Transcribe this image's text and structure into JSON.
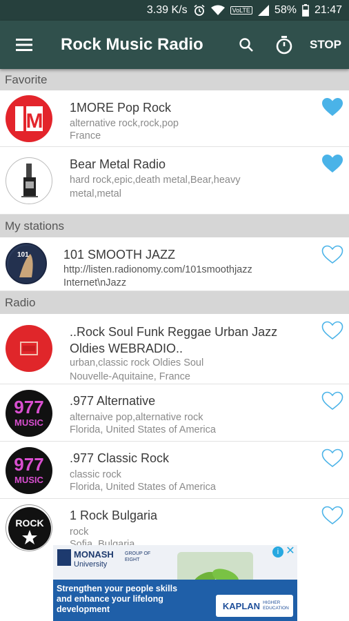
{
  "status_bar": {
    "speed": "3.39 K/s",
    "network_badge": "VoLTE",
    "battery": "58%",
    "time": "21:47"
  },
  "app_bar": {
    "title": "Rock Music Radio",
    "stop_label": "STOP"
  },
  "colors": {
    "app_bar": "#30504c",
    "status_bar": "#26403d",
    "heart": "#4ab3e8",
    "section_bg": "#d6d6d6"
  },
  "sections": {
    "favorite": "Favorite",
    "my_stations": "My stations",
    "radio": "Radio"
  },
  "favorites": [
    {
      "name": "1MORE Pop Rock",
      "tags": "alternative rock,rock,pop",
      "location": "France",
      "favorited": true
    },
    {
      "name": "Bear Metal Radio",
      "tags": "hard rock,epic,death metal,Bear,heavy metal,metal",
      "location": "",
      "favorited": true
    }
  ],
  "my_stations": [
    {
      "name": "101 SMOOTH JAZZ",
      "url": "http://listen.radionomy.com/101smoothjazz",
      "location": "Internet\\nJazz",
      "favorited": false
    }
  ],
  "radio": [
    {
      "name": "..Rock Soul Funk Reggae Urban Jazz Oldies WEBRADIO..",
      "tags": "urban,classic rock Oldies Soul",
      "location": "Nouvelle-Aquitaine, France",
      "favorited": false
    },
    {
      "name": ".977 Alternative",
      "tags": "alternaive pop,alternative rock",
      "location": "Florida, United States of America",
      "favorited": false
    },
    {
      "name": ".977 Classic Rock",
      "tags": "classic rock",
      "location": "Florida, United States of America",
      "favorited": false
    },
    {
      "name": "1 Rock Bulgaria",
      "tags": "rock",
      "location": "Sofia, Bulgaria",
      "favorited": false
    }
  ],
  "logos": {
    "m_letter": "M",
    "music977": "977",
    "music_word": "MUSIC",
    "rock_word": "ROCK",
    "jazz_logo_text": "101"
  },
  "ad": {
    "brand": "MONASH",
    "brand_sub": "University",
    "badge": "GROUP OF EIGHT",
    "headline": "Strengthen your people skills and enhance your lifelong development",
    "partner": "KAPLAN",
    "partner_sub": "HIGHER EDUCATION"
  }
}
